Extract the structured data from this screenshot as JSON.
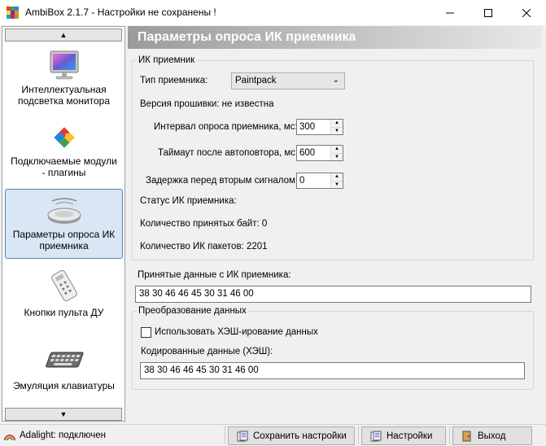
{
  "window": {
    "title": "AmbiBox 2.1.7  - Настройки не сохранены !",
    "min_icon": "minimize-icon",
    "max_icon": "maximize-icon",
    "close_icon": "close-icon"
  },
  "sidebar": {
    "scroll_up_icon": "arrow-up-icon",
    "scroll_down_icon": "arrow-down-icon",
    "items": [
      {
        "label": "Интеллектуальная\nподсветка монитора",
        "icon": "monitor-icon",
        "active": false
      },
      {
        "label": "Подключаемые модули\n- плагины",
        "icon": "puzzle-icon",
        "active": false
      },
      {
        "label": "Параметры опроса ИК\nприемника",
        "icon": "ir-receiver-icon",
        "active": true
      },
      {
        "label": "Кнопки пульта ДУ",
        "icon": "remote-control-icon",
        "active": false
      },
      {
        "label": "Эмуляция клавиатуры",
        "icon": "keyboard-icon",
        "active": false
      }
    ]
  },
  "header": {
    "title": "Параметры опроса ИК приемника"
  },
  "ir_group": {
    "legend": "ИК приемник",
    "receiver_type_label": "Тип приемника:",
    "receiver_type_value": "Paintpack",
    "firmware_label": "Версия прошивки: не известна",
    "poll_interval_label": "Интервал опроса приемника, мс:",
    "poll_interval_value": "300",
    "repeat_timeout_label": "Таймаут после автоповтора, мс:",
    "repeat_timeout_value": "600",
    "second_signal_delay_label": "Задержка перед вторым сигналом:",
    "second_signal_delay_value": "0",
    "status_label": "Статус ИК приемника:",
    "bytes_received_label": "Количество принятых байт: 0",
    "packets_label": "Количество ИК пакетов: 2201"
  },
  "received": {
    "label": "Принятые данные с ИК приемника:",
    "value": "38 30 46 46 45 30 31 46 00"
  },
  "transform_group": {
    "legend": "Преобразование данных",
    "hash_checkbox_label": "Использовать ХЭШ-ирование данных",
    "hash_checked": false,
    "encoded_label": "Кодированные данные (ХЭШ):",
    "encoded_value": "38 30 46 46 45 30 31 46 00"
  },
  "statusbar": {
    "status_text": "Adalight: подключен",
    "status_icon": "connection-status-icon",
    "save_label": "Сохранить настройки",
    "settings_label": "Настройки",
    "exit_label": "Выход"
  },
  "colors": {
    "active_item_bg": "#d9e6f4",
    "active_item_border": "#5b7fb2",
    "header_gradient_start": "#9b9b9b"
  }
}
